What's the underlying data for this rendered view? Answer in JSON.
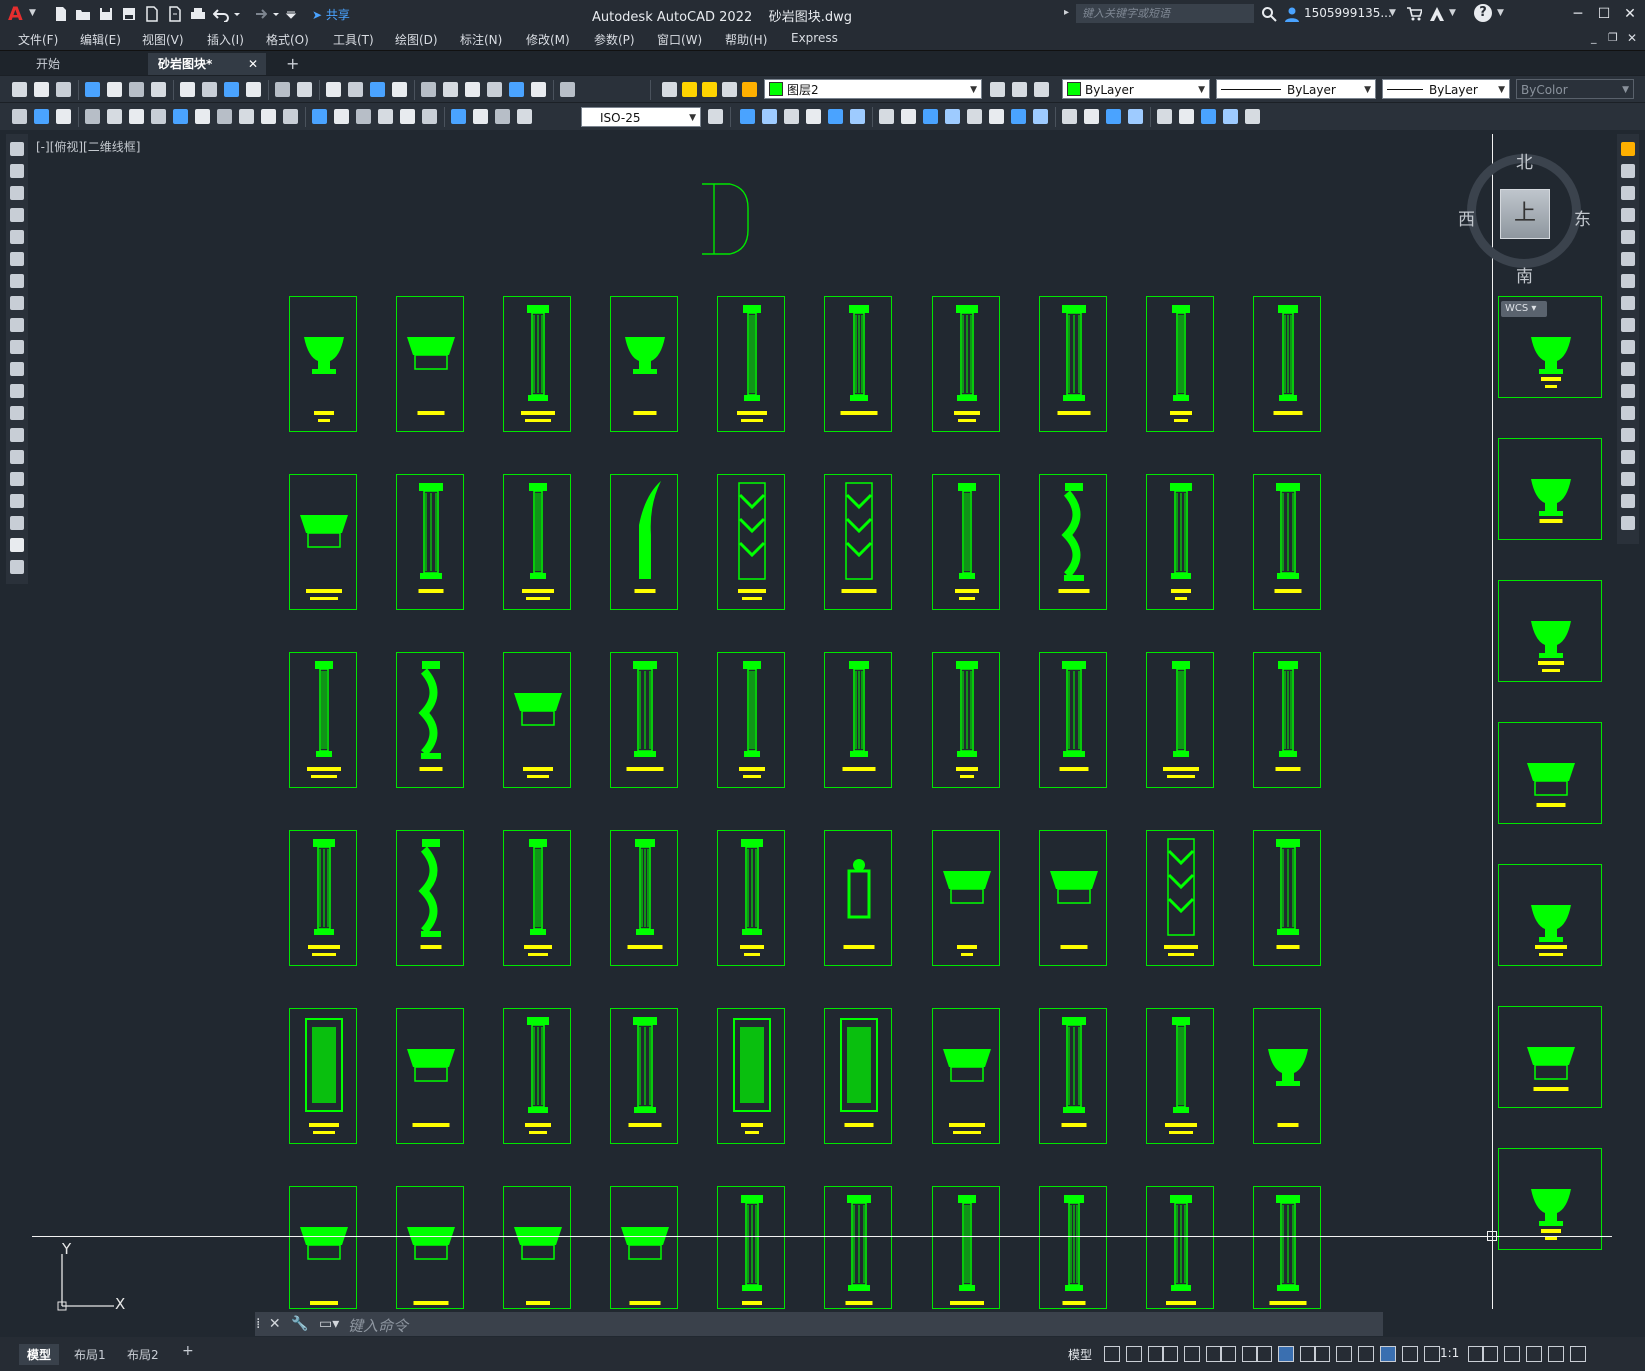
{
  "titlebar": {
    "app_title": "Autodesk AutoCAD 2022",
    "file_name": "砂岩图块.dwg",
    "share_label": "共享",
    "search_placeholder": "键入关键字或短语",
    "user": "1505999135...",
    "help": "?"
  },
  "menu": [
    "文件(F)",
    "编辑(E)",
    "视图(V)",
    "插入(I)",
    "格式(O)",
    "工具(T)",
    "绘图(D)",
    "标注(N)",
    "修改(M)",
    "参数(P)",
    "窗口(W)",
    "帮助(H)",
    "Express"
  ],
  "tabs": {
    "start": "开始",
    "active": "砂岩图块*",
    "close": "✕",
    "add": "+"
  },
  "toolbar": {
    "layer": "图层2",
    "color": "ByLayer",
    "linetype": "ByLayer",
    "lineweight": "ByLayer",
    "plotstyle": "ByColor",
    "dimstyle": "ISO-25"
  },
  "viewport": {
    "label": "[-][俯视][二维线框]",
    "title_letter": "D",
    "ucs_x": "X",
    "ucs_y": "Y"
  },
  "viewcube": {
    "north": "北",
    "south": "南",
    "east": "东",
    "west": "西",
    "top": "上",
    "wcs": "WCS"
  },
  "command": {
    "placeholder": "键入命令"
  },
  "statusbar": {
    "layouts": [
      "模型",
      "布局1",
      "布局2"
    ],
    "add": "+",
    "model": "模型",
    "scale": "1:1"
  },
  "colors": {
    "block_green": "#00ff00",
    "label_yellow": "#ffff00",
    "background": "#212830",
    "accent_blue": "#4aa3ff"
  },
  "block_grid": {
    "rows": 6,
    "cols": 10,
    "kinds": [
      [
        "urn",
        "cap",
        "col",
        "urn",
        "col",
        "col",
        "col",
        "col",
        "col",
        "col"
      ],
      [
        "cap",
        "col",
        "col",
        "blade",
        "zig",
        "zig",
        "col",
        "twist",
        "col",
        "col"
      ],
      [
        "col",
        "twist",
        "cap",
        "col",
        "col",
        "col",
        "col",
        "col",
        "col",
        "col"
      ],
      [
        "col",
        "twist",
        "col",
        "col",
        "col",
        "lamp",
        "cap",
        "cap",
        "zig",
        "col"
      ],
      [
        "panel",
        "cap",
        "col",
        "col",
        "panel",
        "panel",
        "cap",
        "col",
        "col",
        "urn"
      ],
      [
        "cap",
        "cap",
        "cap",
        "cap",
        "col",
        "col",
        "col",
        "col",
        "col",
        "col"
      ]
    ],
    "right_column": [
      "urn",
      "urn",
      "urn",
      "cap",
      "urn",
      "cap",
      "urn"
    ]
  }
}
